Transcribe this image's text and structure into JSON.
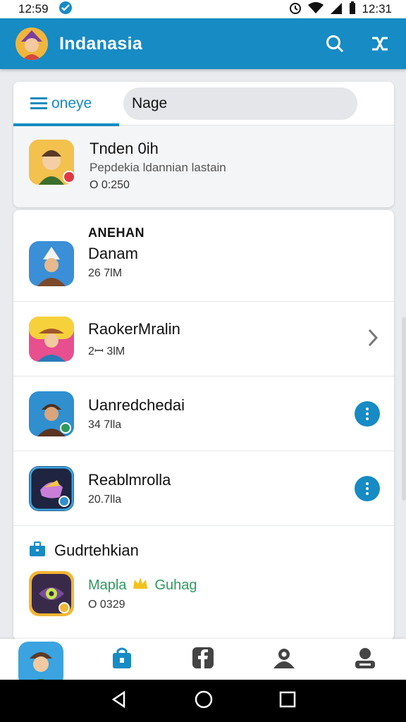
{
  "status_bar": {
    "time_left": "12:59",
    "time_right": "12:31"
  },
  "app_bar": {
    "title": "Indanasia",
    "avatar_icon": "person-avatar",
    "actions": [
      "search-icon",
      "shuffle-icon"
    ]
  },
  "top_card": {
    "tab_label": "oneye",
    "search_value": "Nage",
    "featured": {
      "title": "Tnden 0ih",
      "subtitle": "Pepdekia ldannian lastain",
      "meta": "O 0:250"
    }
  },
  "list": {
    "section_title": "ANEHAN",
    "items": [
      {
        "title": "Danam",
        "meta": "26 7lM",
        "action": "none"
      },
      {
        "title": "RaokerMralin",
        "meta": "2ꟷ 3lM",
        "action": "chevron"
      },
      {
        "title": "Uanredchedai",
        "meta": "34 7lla",
        "action": "more"
      },
      {
        "title": "Reablmrolla",
        "meta": "20.7lla",
        "action": "more"
      }
    ]
  },
  "section2": {
    "title": "Gudrtehkian",
    "item": {
      "title_a": "Mapla",
      "title_b": "Guhag",
      "meta": "O 0329"
    }
  },
  "colors": {
    "primary": "#168bc4",
    "accent_green": "#2e9a5e",
    "badge_red": "#e23844"
  },
  "bottom_nav": [
    "profile-avatar",
    "shopping-bag-icon",
    "facebook-icon",
    "user-icon",
    "account-icon"
  ]
}
